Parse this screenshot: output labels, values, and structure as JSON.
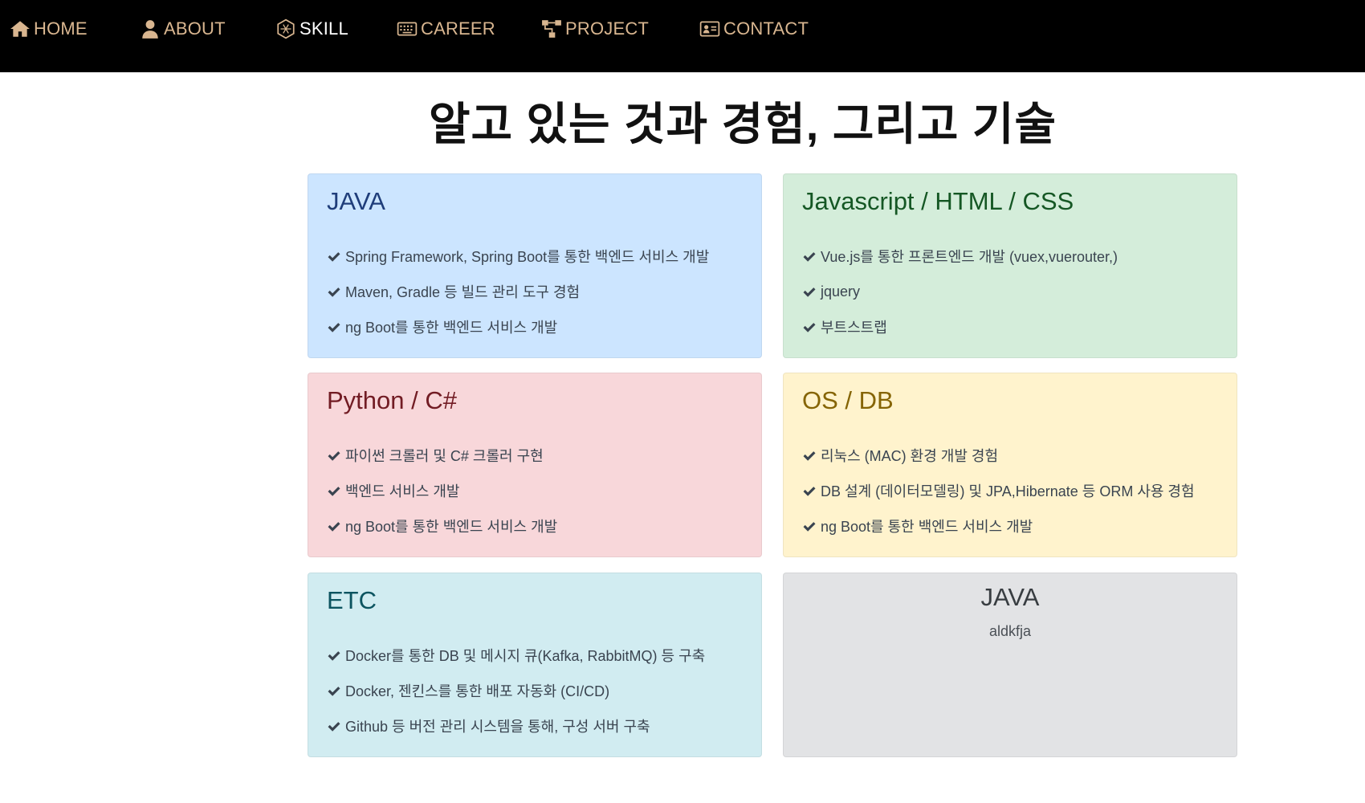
{
  "nav": {
    "items": [
      {
        "label": "HOME",
        "icon": "home-icon"
      },
      {
        "label": "ABOUT",
        "icon": "user-icon"
      },
      {
        "label": "SKILL",
        "icon": "hexagon-icon"
      },
      {
        "label": "CAREER",
        "icon": "keyboard-icon"
      },
      {
        "label": "PROJECT",
        "icon": "sitemap-icon"
      },
      {
        "label": "CONTACT",
        "icon": "id-card-icon"
      }
    ],
    "colors": {
      "background": "#000000",
      "text": "#d9b690"
    }
  },
  "page": {
    "title": "알고 있는 것과 경험, 그리고 기술"
  },
  "cards": [
    {
      "title": "JAVA",
      "colors": {
        "background": "#cce5ff",
        "title": "#1f3d7a"
      },
      "items": [
        "Spring Framework, Spring Boot를 통한 백엔드 서비스 개발",
        "Maven, Gradle 등 빌드 관리 도구 경험",
        "ng Boot를 통한 백엔드 서비스 개발"
      ]
    },
    {
      "title": "Javascript / HTML / CSS",
      "colors": {
        "background": "#d4edda",
        "title": "#155724"
      },
      "items": [
        "Vue.js를 통한 프론트엔드 개발 (vuex,vuerouter,)",
        "jquery",
        "부트스트랩"
      ]
    },
    {
      "title": "Python / C#",
      "colors": {
        "background": "#f8d7da",
        "title": "#721c24"
      },
      "items": [
        "파이썬 크롤러 및 C# 크롤러 구현",
        "백엔드 서비스 개발",
        "ng Boot를 통한 백엔드 서비스 개발"
      ]
    },
    {
      "title": "OS / DB",
      "colors": {
        "background": "#fff3cd",
        "title": "#856404"
      },
      "items": [
        "리눅스 (MAC) 환경 개발 경험",
        "DB 설계 (데이터모델링) 및 JPA,Hibernate 등 ORM 사용 경험",
        "ng Boot를 통한 백엔드 서비스 개발"
      ]
    },
    {
      "title": "ETC",
      "colors": {
        "background": "#d1ecf1",
        "title": "#0c5460"
      },
      "items": [
        "Docker를 통한 DB 및 메시지 큐(Kafka, RabbitMQ) 등 구축",
        "Docker, 젠킨스를 통한 배포 자동화 (CI/CD)",
        "Github 등 버전 관리 시스템을 통해, 구성 서버 구축"
      ]
    }
  ],
  "extra_card": {
    "title": "JAVA",
    "subtitle": "aldkfja",
    "colors": {
      "background": "#e2e3e5",
      "title": "#383d41"
    }
  }
}
